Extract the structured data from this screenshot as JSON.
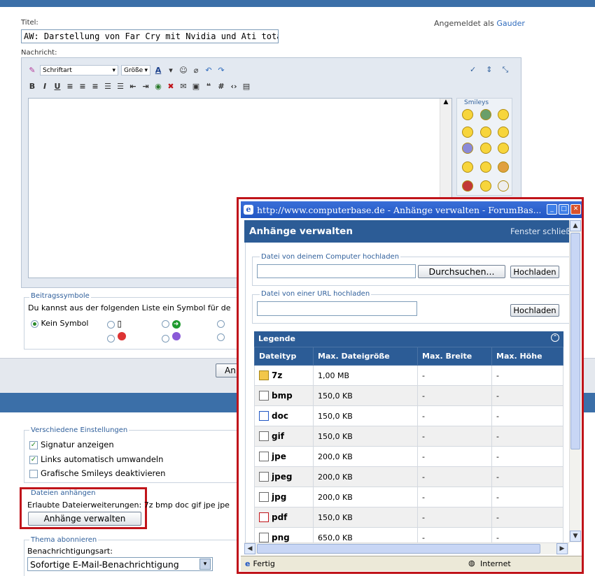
{
  "colors": {
    "accent": "#3b6fa8",
    "highlight": "#c0141a",
    "header_bg": "#2c5c96"
  },
  "form": {
    "title_label": "Titel:",
    "title_value": "AW: Darstellung von Far Cry mit Nvidia und Ati total ur",
    "logged_in_prefix": "Angemeldet als",
    "logged_in_user": "Gauder",
    "message_label": "Nachricht:",
    "font_select": "Schriftart",
    "size_select": "Größe",
    "smileys_title": "Smileys"
  },
  "post_icons": {
    "legend": "Beitragssymbole",
    "desc": "Du kannst aus der folgenden Liste ein Symbol für de",
    "none_label": "Kein Symbol"
  },
  "submit_partial": "An",
  "settings": {
    "legend": "Verschiedene Einstellungen",
    "options": [
      {
        "label": "Signatur anzeigen",
        "checked": "✓"
      },
      {
        "label": "Links automatisch umwandeln",
        "checked": "✓"
      },
      {
        "label": "Grafische Smileys deaktivieren",
        "checked": ""
      }
    ]
  },
  "attachments": {
    "legend": "Dateien anhängen",
    "allowed": "Erlaubte Dateierweiterungen: 7z bmp doc gif jpe jpe",
    "manage_button": "Anhänge verwalten"
  },
  "subscribe": {
    "legend": "Thema abonnieren",
    "label": "Benachrichtigungsart:",
    "value": "Sofortige E-Mail-Benachrichtigung"
  },
  "popup": {
    "window_title": "http://www.computerbase.de - Anhänge verwalten - ForumBas...",
    "heading": "Anhänge verwalten",
    "close_link": "Fenster schließ",
    "upload_computer_legend": "Datei von deinem Computer hochladen",
    "browse_button": "Durchsuchen...",
    "upload_button": "Hochladen",
    "upload_url_legend": "Datei von einer URL hochladen",
    "upload_button_2": "Hochladen",
    "legend_title": "Legende",
    "columns": [
      "Dateityp",
      "Max. Dateigröße",
      "Max. Breite",
      "Max. Höhe"
    ],
    "rows": [
      {
        "type": "7z",
        "size": "1,00 MB",
        "width": "-",
        "height": "-",
        "icon": "archive-icon"
      },
      {
        "type": "bmp",
        "size": "150,0 KB",
        "width": "-",
        "height": "-",
        "icon": "image-icon"
      },
      {
        "type": "doc",
        "size": "150,0 KB",
        "width": "-",
        "height": "-",
        "icon": "word-icon"
      },
      {
        "type": "gif",
        "size": "150,0 KB",
        "width": "-",
        "height": "-",
        "icon": "image-icon"
      },
      {
        "type": "jpe",
        "size": "200,0 KB",
        "width": "-",
        "height": "-",
        "icon": "image-icon"
      },
      {
        "type": "jpeg",
        "size": "200,0 KB",
        "width": "-",
        "height": "-",
        "icon": "image-icon"
      },
      {
        "type": "jpg",
        "size": "200,0 KB",
        "width": "-",
        "height": "-",
        "icon": "image-icon"
      },
      {
        "type": "pdf",
        "size": "150,0 KB",
        "width": "-",
        "height": "-",
        "icon": "pdf-icon"
      },
      {
        "type": "png",
        "size": "650,0 KB",
        "width": "-",
        "height": "-",
        "icon": "image-icon"
      }
    ],
    "status_text": "Fertig",
    "zone_text": "Internet"
  }
}
